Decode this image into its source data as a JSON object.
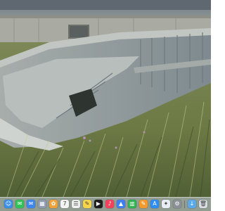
{
  "screen": {
    "wallpaper": {
      "sky": "#7d8a8f",
      "building": "#a8a9a0",
      "boat_hull": "#8f9899",
      "grass_dark": "#4d5a3a",
      "grass_light": "#9aa36a"
    },
    "dock": {
      "background": "#c9d3df",
      "items": [
        {
          "name": "finder-icon",
          "color": "#3a8ee6",
          "glyph": "☺"
        },
        {
          "name": "messages-icon",
          "color": "#33c15a",
          "glyph": "✉"
        },
        {
          "name": "mail-icon",
          "color": "#3d86ee",
          "glyph": "✉"
        },
        {
          "name": "launchpad-icon",
          "color": "#8f9bb0",
          "glyph": "▦"
        },
        {
          "name": "photos-icon",
          "color": "#f2a23a",
          "glyph": "✿"
        },
        {
          "name": "calendar-icon",
          "color": "#f3f3f3",
          "glyph": "7"
        },
        {
          "name": "reminders-icon",
          "color": "#eeeeee",
          "glyph": "☰"
        },
        {
          "name": "notes-icon",
          "color": "#f6d54a",
          "glyph": "✎"
        },
        {
          "name": "apple-tv-icon",
          "color": "#1d1d1d",
          "glyph": "▶"
        },
        {
          "name": "music-icon",
          "color": "#f4425c",
          "glyph": "♪"
        },
        {
          "name": "keynote-icon",
          "color": "#3d7ff0",
          "glyph": "▲"
        },
        {
          "name": "numbers-icon",
          "color": "#2fb24f",
          "glyph": "▥"
        },
        {
          "name": "pages-icon",
          "color": "#f29a2e",
          "glyph": "✎"
        },
        {
          "name": "app-store-icon",
          "color": "#2f8cf0",
          "glyph": "A"
        },
        {
          "name": "safari-icon",
          "color": "#e9eef5",
          "glyph": "✦"
        },
        {
          "name": "system-settings-icon",
          "color": "#8b8f96",
          "glyph": "⚙"
        },
        {
          "name": "downloads-folder-icon",
          "color": "#5aa9e8",
          "glyph": "↓"
        },
        {
          "name": "trash-icon",
          "color": "#d9dde3",
          "glyph": "🗑"
        }
      ]
    }
  }
}
